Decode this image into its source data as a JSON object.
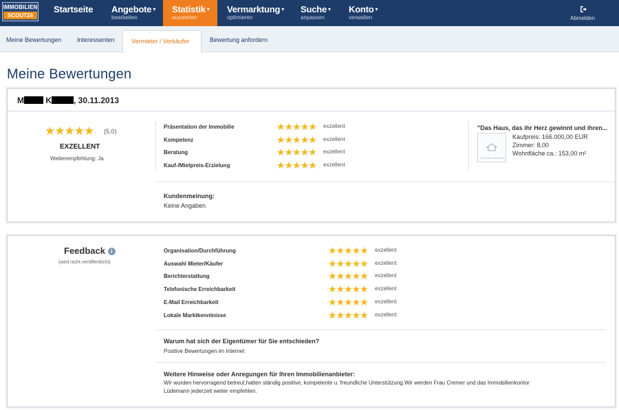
{
  "nav": {
    "logo_line1": "IMMOBILIEN",
    "logo_line2": "SCOUT24",
    "items": [
      {
        "label": "Startseite",
        "sub": "",
        "caret": ""
      },
      {
        "label": "Angebote",
        "sub": "bearbeiten",
        "caret": "▾"
      },
      {
        "label": "Statistik",
        "sub": "auswerten",
        "caret": "▾"
      },
      {
        "label": "Vermarktung",
        "sub": "optimieren",
        "caret": "▾"
      },
      {
        "label": "Suche",
        "sub": "anpassen",
        "caret": "▾"
      },
      {
        "label": "Konto",
        "sub": "verwalten",
        "caret": "▾"
      }
    ],
    "logout": "Abmelden",
    "active_color": "#f07d1e",
    "bar_color": "#1d3c69"
  },
  "subnav": {
    "tabs": [
      "Meine Bewertungen",
      "Interessenten",
      "Vermieter / Verkäufer",
      "Bewertung anfordern"
    ]
  },
  "page_title": "Meine Bewertungen",
  "review": {
    "name_first_initial": "M",
    "name_last_initial": "K",
    "date_suffix": ", 30.11.2013",
    "overall_stars": "★★★★★",
    "overall_score": "(5,0)",
    "overall_label": "EXZELLENT",
    "recommendation": "Weiterempfehlung: Ja",
    "ratings": [
      {
        "label": "Präsentation der Immobilie",
        "value": "exzellent",
        "stars": 5
      },
      {
        "label": "Kompetenz",
        "value": "exzellent",
        "stars": 5
      },
      {
        "label": "Beratung",
        "value": "exzellent",
        "stars": 5
      },
      {
        "label": "Kauf-/Mietpreis-Erzielung",
        "value": "exzellent",
        "stars": 5
      }
    ],
    "listing": {
      "title": "\"Das Haus, das ihr Herz gewinnt und ihren...",
      "price": "Kaufpreis: 166.000,00 EUR",
      "rooms": "Zimmer: 8,00",
      "area": "Wohnfläche ca.: 153,00 m²",
      "thumb_caption": "Kein Bild vorhanden"
    },
    "opinion_heading": "Kundenmeinung:",
    "opinion_text": "Keine Angaben"
  },
  "feedback": {
    "title": "Feedback",
    "info_icon": "i",
    "note": "(wird nicht veröffentlicht)",
    "ratings": [
      {
        "label": "Organisation/Durchführung",
        "value": "exzellent",
        "stars": 5
      },
      {
        "label": "Auswahl Mieter/Käufer",
        "value": "exzellent",
        "stars": 5
      },
      {
        "label": "Berichterstattung",
        "value": "exzellent",
        "stars": 5
      },
      {
        "label": "Telefonische Erreichbarkeit",
        "value": "exzellent",
        "stars": 5
      },
      {
        "label": "E-Mail Erreichbarkeit",
        "value": "exzellent",
        "stars": 5
      },
      {
        "label": "Lokale Marktkenntnisse",
        "value": "exzellent",
        "stars": 5
      }
    ],
    "q1_heading": "Warum hat sich der Eigentümer für Sie entschieden?",
    "q1_text": "Positive Bewertungen im Internet",
    "q2_heading": "Weitere Hinweise oder Anregungen für Ihren Immobilienanbieter:",
    "q2_text_line1": "Wir wurden hervorragend betreut,hatten ständig positive, kompetente u. freundliche Unterstützung.Wir werden Frau Cremer und das Immobilienkontor",
    "q2_text_line2": "Lüdemann jederzeit weiter empfehlen."
  },
  "icons": {
    "star": "star-icon",
    "logout": "logout-icon",
    "info": "info-icon",
    "house": "house-icon"
  }
}
